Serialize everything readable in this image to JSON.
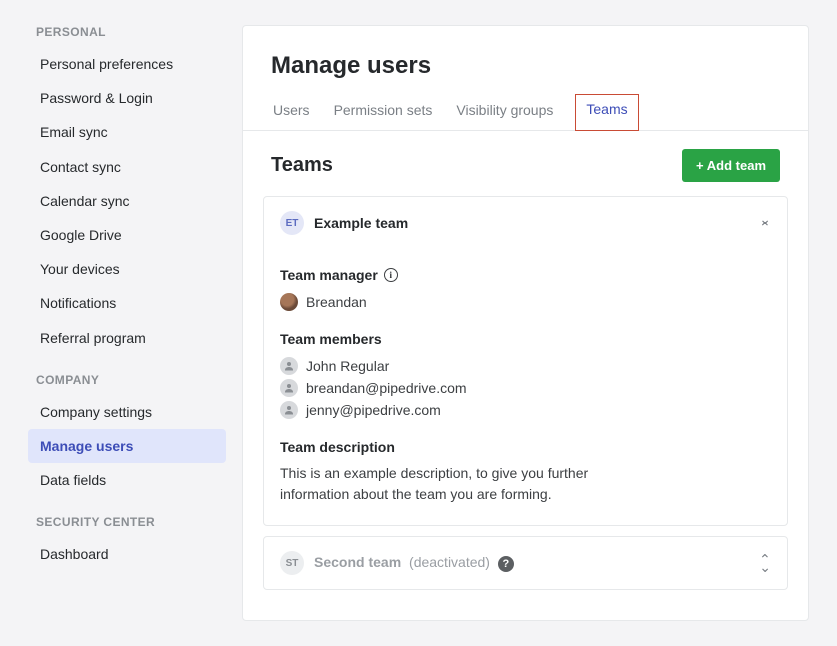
{
  "sidebar": {
    "sections": [
      {
        "header": "PERSONAL",
        "items": [
          {
            "label": "Personal preferences",
            "active": false
          },
          {
            "label": "Password & Login",
            "active": false
          },
          {
            "label": "Email sync",
            "active": false
          },
          {
            "label": "Contact sync",
            "active": false
          },
          {
            "label": "Calendar sync",
            "active": false
          },
          {
            "label": "Google Drive",
            "active": false
          },
          {
            "label": "Your devices",
            "active": false
          },
          {
            "label": "Notifications",
            "active": false
          },
          {
            "label": "Referral program",
            "active": false
          }
        ]
      },
      {
        "header": "COMPANY",
        "items": [
          {
            "label": "Company settings",
            "active": false
          },
          {
            "label": "Manage users",
            "active": true
          },
          {
            "label": "Data fields",
            "active": false
          }
        ]
      },
      {
        "header": "SECURITY CENTER",
        "items": [
          {
            "label": "Dashboard",
            "active": false
          }
        ]
      }
    ]
  },
  "page": {
    "title": "Manage users",
    "tabs": [
      {
        "label": "Users",
        "active": false
      },
      {
        "label": "Permission sets",
        "active": false
      },
      {
        "label": "Visibility groups",
        "active": false
      },
      {
        "label": "Teams",
        "active": true
      }
    ],
    "section_title": "Teams",
    "add_button": "+ Add team"
  },
  "teams": [
    {
      "badge": "ET",
      "name": "Example team",
      "expanded": true,
      "manager_label": "Team manager",
      "manager": "Breandan",
      "members_label": "Team members",
      "members": [
        {
          "name": "John Regular"
        },
        {
          "name": "breandan@pipedrive.com"
        },
        {
          "name": "jenny@pipedrive.com"
        }
      ],
      "description_label": "Team description",
      "description": "This is an example description, to give you further information about the team you are forming."
    },
    {
      "badge": "ST",
      "name": "Second team",
      "status": "(deactivated)",
      "expanded": false
    }
  ]
}
